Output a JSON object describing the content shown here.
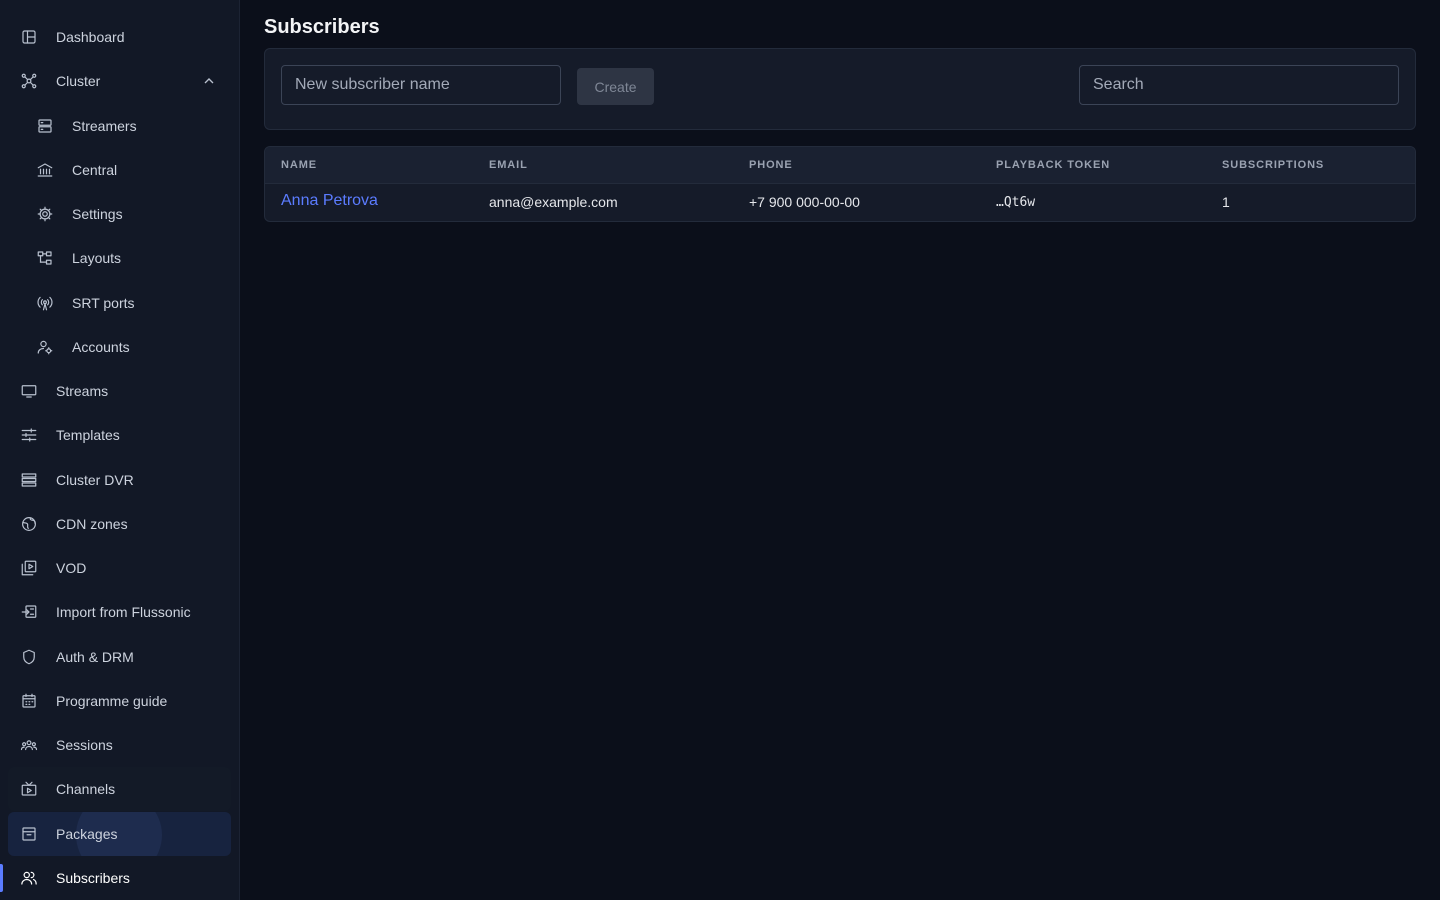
{
  "sidebar": {
    "items": [
      {
        "label": "Dashboard",
        "icon": "dashboard-icon"
      },
      {
        "label": "Cluster",
        "icon": "cluster-icon"
      },
      {
        "label": "Streamers",
        "icon": "server-icon"
      },
      {
        "label": "Central",
        "icon": "bank-icon"
      },
      {
        "label": "Settings",
        "icon": "gear-icon"
      },
      {
        "label": "Layouts",
        "icon": "hierarchy-icon"
      },
      {
        "label": "SRT ports",
        "icon": "antenna-icon"
      },
      {
        "label": "Accounts",
        "icon": "user-gear-icon"
      },
      {
        "label": "Streams",
        "icon": "monitor-icon"
      },
      {
        "label": "Templates",
        "icon": "sliders-icon"
      },
      {
        "label": "Cluster DVR",
        "icon": "storage-icon"
      },
      {
        "label": "CDN zones",
        "icon": "globe-icon"
      },
      {
        "label": "VOD",
        "icon": "video-library-icon"
      },
      {
        "label": "Import from Flussonic",
        "icon": "import-icon"
      },
      {
        "label": "Auth & DRM",
        "icon": "shield-icon"
      },
      {
        "label": "Programme guide",
        "icon": "calendar-icon"
      },
      {
        "label": "Sessions",
        "icon": "groups-icon"
      },
      {
        "label": "Channels",
        "icon": "tv-icon"
      },
      {
        "label": "Packages",
        "icon": "archive-icon"
      },
      {
        "label": "Subscribers",
        "icon": "users-icon"
      }
    ]
  },
  "page": {
    "title": "Subscribers"
  },
  "toolbar": {
    "name_placeholder": "New subscriber name",
    "create_label": "Create",
    "search_placeholder": "Search"
  },
  "table": {
    "headers": [
      "NAME",
      "EMAIL",
      "PHONE",
      "PLAYBACK TOKEN",
      "SUBSCRIPTIONS"
    ],
    "rows": [
      {
        "name": "Anna Petrova",
        "email": "anna@example.com",
        "phone": "+7 900 000-00-00",
        "token": "…Qt6w",
        "subscriptions": "1"
      }
    ]
  },
  "colors": {
    "accent": "#5b7cff",
    "background": "#0b0f1a",
    "sidebar": "#121826",
    "card": "#151b29"
  }
}
